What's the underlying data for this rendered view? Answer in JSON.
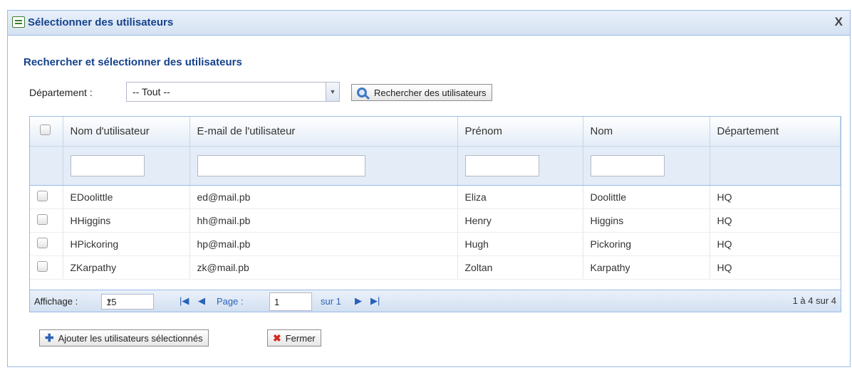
{
  "window": {
    "title": "Sélectionner des utilisateurs",
    "close_glyph": "X"
  },
  "search": {
    "section_title": "Rechercher et sélectionner des utilisateurs",
    "department_label": "Département :",
    "department_value": "-- Tout --",
    "search_button": "Rechercher des utilisateurs"
  },
  "grid": {
    "columns": [
      "Nom d'utilisateur",
      "E-mail de l'utilisateur",
      "Prénom",
      "Nom",
      "Département"
    ],
    "rows": [
      {
        "username": "EDoolittle",
        "email": "ed@mail.pb",
        "first": "Eliza",
        "last": "Doolittle",
        "dept": "HQ"
      },
      {
        "username": "HHiggins",
        "email": "hh@mail.pb",
        "first": "Henry",
        "last": "Higgins",
        "dept": "HQ"
      },
      {
        "username": "HPickoring",
        "email": "hp@mail.pb",
        "first": "Hugh",
        "last": "Pickoring",
        "dept": "HQ"
      },
      {
        "username": "ZKarpathy",
        "email": "zk@mail.pb",
        "first": "Zoltan",
        "last": "Karpathy",
        "dept": "HQ"
      }
    ]
  },
  "pager": {
    "display_label": "Affichage :",
    "page_size": "15",
    "page_label": "Page :",
    "page_value": "1",
    "of_label": "sur 1",
    "range_text": "1 à 4 sur 4"
  },
  "actions": {
    "add_label": "Ajouter les utilisateurs sélectionnés",
    "close_label": "Fermer"
  }
}
